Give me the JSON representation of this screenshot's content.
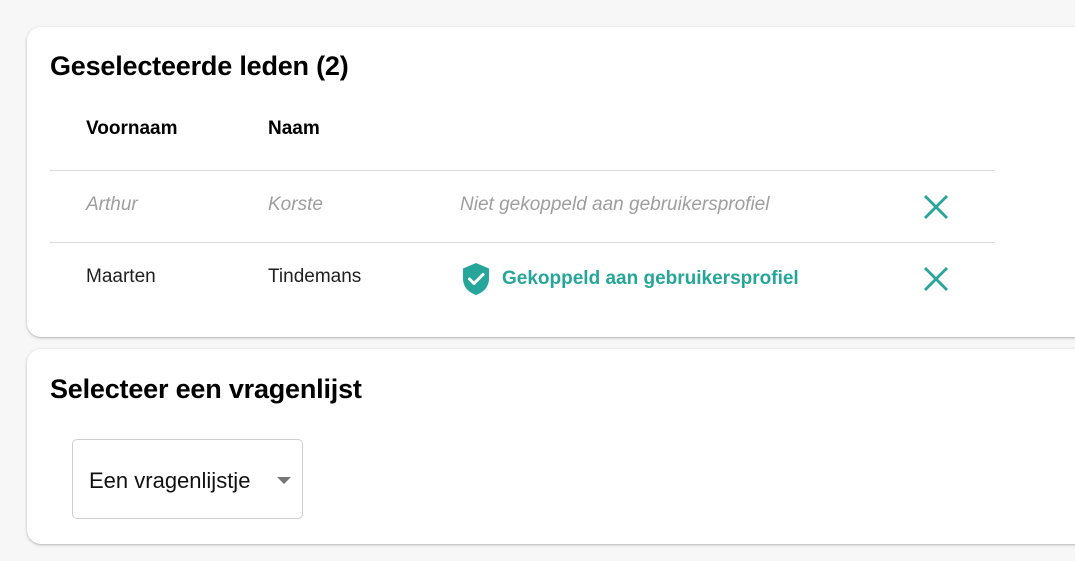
{
  "members_card": {
    "title": "Geselecteerde leden (2)",
    "columns": {
      "first_name": "Voornaam",
      "last_name": "Naam"
    },
    "rows": [
      {
        "first_name": "Arthur",
        "last_name": "Korste",
        "status": "Niet gekoppeld aan gebruikersprofiel",
        "linked": false,
        "remove_icon": "close-icon"
      },
      {
        "first_name": "Maarten",
        "last_name": "Tindemans",
        "status": "Gekoppeld aan gebruikersprofiel",
        "linked": true,
        "status_icon": "verified-shield-icon",
        "remove_icon": "close-icon"
      }
    ]
  },
  "questionnaire_card": {
    "title": "Selecteer een vragenlijst",
    "select": {
      "selected_value": "Een vragenlijstje",
      "icon": "dropdown-arrow-icon"
    }
  },
  "colors": {
    "accent": "#26a69a",
    "muted_text": "#9e9e9e",
    "divider": "#d9d9d9",
    "page_background": "#f7f7f7",
    "card_background": "#ffffff"
  }
}
